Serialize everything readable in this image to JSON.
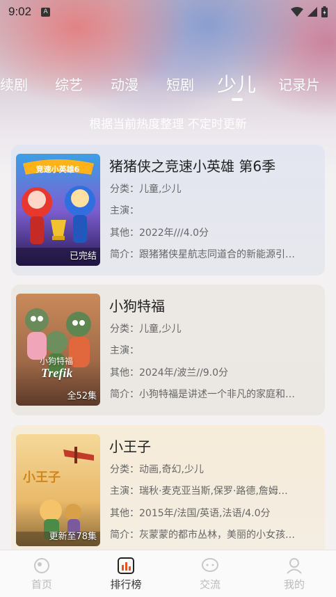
{
  "status": {
    "time": "9:02",
    "notification_icon": "a-letter-icon"
  },
  "tabs": {
    "items": [
      {
        "label": "续剧"
      },
      {
        "label": "综艺"
      },
      {
        "label": "动漫"
      },
      {
        "label": "短剧"
      },
      {
        "label": "少儿",
        "active": true
      },
      {
        "label": "记录片"
      }
    ]
  },
  "subtitle": "根据当前热度整理 不定时更新",
  "cards": [
    {
      "title": "猪猪侠之竞速小英雄 第6季",
      "category": "分类：儿童,少儿",
      "cast": "主演：",
      "other": "其他：2022年///4.0分",
      "intro": "简介：跟猪猪侠星航志同道合的新能源引…",
      "badge": "已完结",
      "poster_text": "竞速小英雄6"
    },
    {
      "title": "小狗特福",
      "category": "分类：儿童,少儿",
      "cast": "主演：",
      "other": "其他：2024年/波兰//9.0分",
      "intro": "简介：小狗特福是讲述一个非凡的家庭和…",
      "badge": "全52集",
      "poster_text": "小狗特福",
      "poster_logo": "Trefik"
    },
    {
      "title": "小王子",
      "category": "分类：动画,奇幻,少儿",
      "cast": "主演：瑞秋·麦克亚当斯,保罗·路德,詹姆…",
      "other": "其他：2015年/法国/英语,法语/4.0分",
      "intro": "简介：灰蒙蒙的都市丛林，美丽的小女孩…",
      "badge": "更新至78集",
      "poster_text": "小王子"
    }
  ],
  "bottom_nav": [
    {
      "label": "首页",
      "icon": "home-icon"
    },
    {
      "label": "排行榜",
      "icon": "ranking-icon",
      "active": true
    },
    {
      "label": "交流",
      "icon": "chat-icon"
    },
    {
      "label": "我的",
      "icon": "profile-icon"
    }
  ],
  "colors": {
    "accent_text": "#222222",
    "inactive_nav": "#bbbbbb"
  }
}
